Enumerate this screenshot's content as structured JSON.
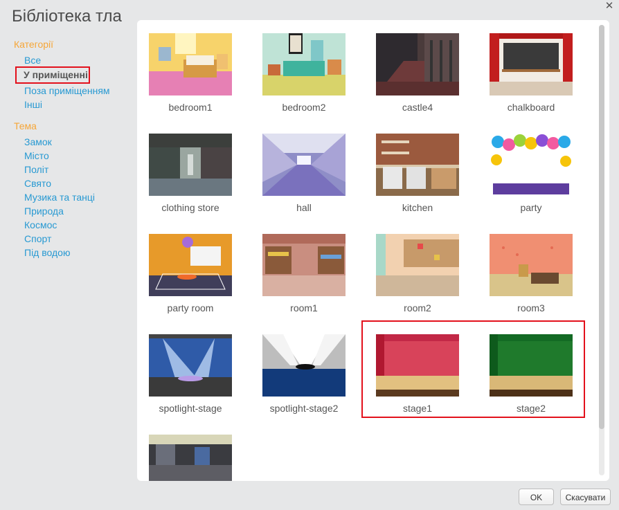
{
  "dialog": {
    "title": "Бібліотека тла",
    "close_glyph": "✕",
    "ok_label": "OK",
    "cancel_label": "Скасувати"
  },
  "sidebar": {
    "categories_label": "Категорії",
    "categories": [
      "Все",
      "У приміщенні",
      "Поза приміщенням",
      "Інші"
    ],
    "active_category": "У приміщенні",
    "theme_label": "Тема",
    "themes": [
      "Замок",
      "Місто",
      "Політ",
      "Свято",
      "Музика та танці",
      "Природа",
      "Космос",
      "Спорт",
      "Під водою"
    ]
  },
  "backdrops": [
    {
      "name": "bedroom1",
      "icon": "bedroom1-thumbnail"
    },
    {
      "name": "bedroom2",
      "icon": "bedroom2-thumbnail"
    },
    {
      "name": "castle4",
      "icon": "castle4-thumbnail"
    },
    {
      "name": "chalkboard",
      "icon": "chalkboard-thumbnail"
    },
    {
      "name": "clothing store",
      "icon": "clothing-store-thumbnail"
    },
    {
      "name": "hall",
      "icon": "hall-thumbnail"
    },
    {
      "name": "kitchen",
      "icon": "kitchen-thumbnail"
    },
    {
      "name": "party",
      "icon": "party-thumbnail"
    },
    {
      "name": "party room",
      "icon": "party-room-thumbnail"
    },
    {
      "name": "room1",
      "icon": "room1-thumbnail"
    },
    {
      "name": "room2",
      "icon": "room2-thumbnail"
    },
    {
      "name": "room3",
      "icon": "room3-thumbnail"
    },
    {
      "name": "spotlight-stage",
      "icon": "spotlight-stage-thumbnail"
    },
    {
      "name": "spotlight-stage2",
      "icon": "spotlight-stage2-thumbnail"
    },
    {
      "name": "stage1",
      "icon": "stage1-thumbnail"
    },
    {
      "name": "stage2",
      "icon": "stage2-thumbnail"
    },
    {
      "name": "",
      "icon": "theater-thumbnail"
    }
  ],
  "colors": {
    "accent_orange": "#f6a637",
    "link_blue": "#2799d2",
    "highlight_red": "#e3101b"
  }
}
